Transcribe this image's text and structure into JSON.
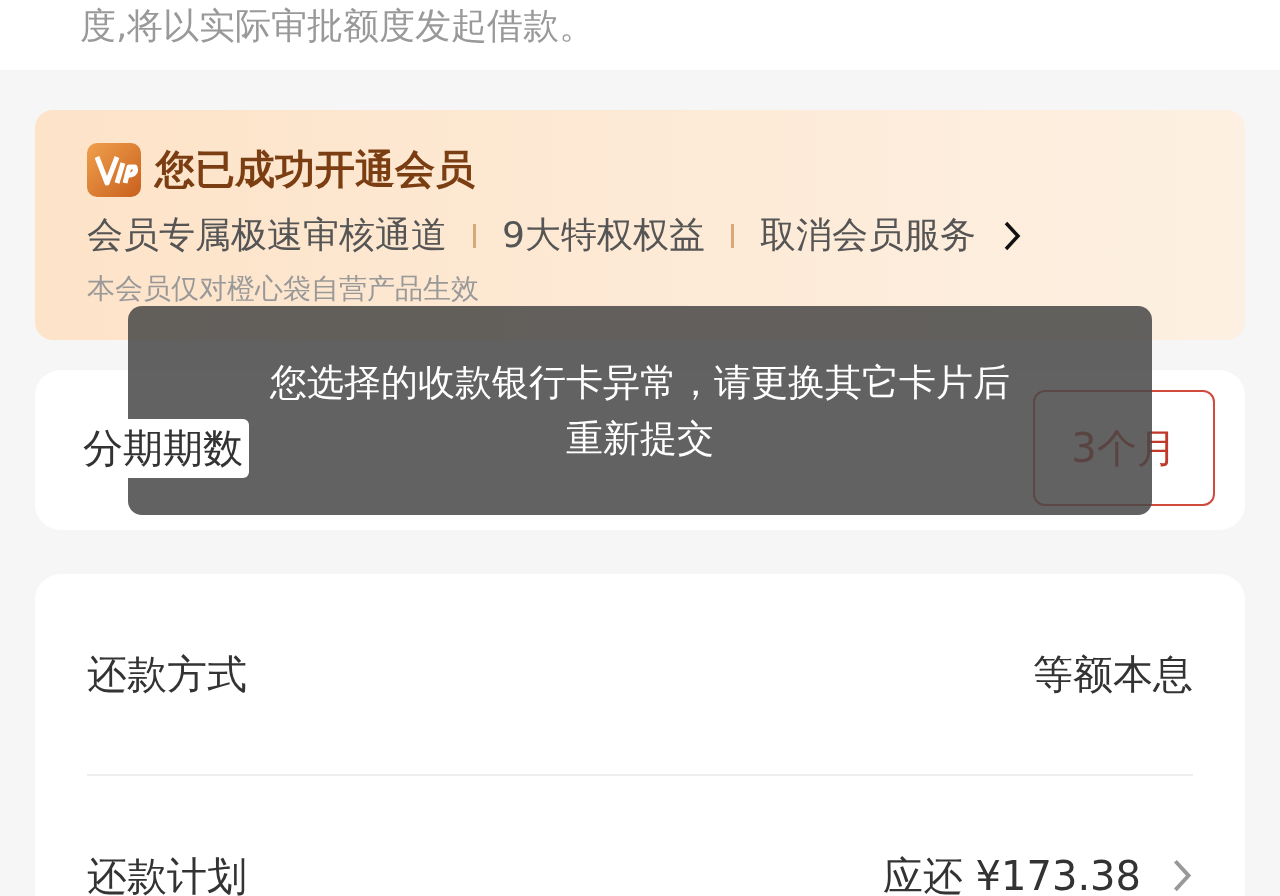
{
  "notice": "度,将以实际审批额度发起借款。",
  "membership": {
    "title": "您已成功开通会员",
    "links": [
      "会员专属极速审核通道",
      "9大特权权益",
      "取消会员服务"
    ],
    "note": "本会员仅对橙心袋自营产品生效"
  },
  "installments": {
    "label": "分期期数",
    "options": [
      {
        "label": "3个月",
        "selected": true
      }
    ]
  },
  "repayment": [
    {
      "kind": "value",
      "label": "还款方式",
      "value": "等额本息"
    },
    {
      "kind": "link",
      "label": "还款计划",
      "value": "应还 ¥173.38"
    }
  ],
  "toast": [
    "您选择的收款银行卡异常，请更换其它卡片后",
    "重新提交"
  ]
}
